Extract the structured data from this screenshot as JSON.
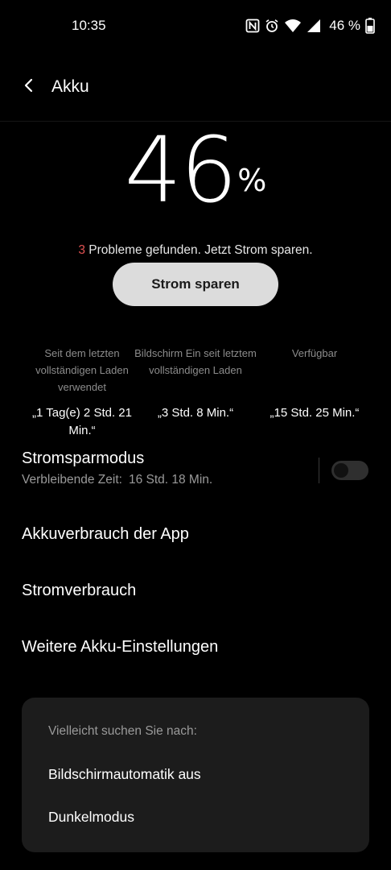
{
  "status_bar": {
    "time": "10:35",
    "icons": [
      "nfc-icon",
      "alarm-icon",
      "wifi-icon",
      "signal-icon",
      "battery-icon"
    ],
    "battery_text": "46 %"
  },
  "app_bar": {
    "title": "Akku"
  },
  "battery": {
    "level": "46",
    "unit": "%"
  },
  "problems": {
    "count": "3",
    "text": " Probleme gefunden. Jetzt Strom sparen."
  },
  "save_button": {
    "label": "Strom sparen"
  },
  "stats": [
    {
      "label": "Seit dem letzten vollständigen Laden verwendet",
      "value": "„1 Tag(e) 2 Std. 21 Min.“"
    },
    {
      "label": "Bildschirm Ein seit letztem vollständigen Laden",
      "value": "„3 Std. 8 Min.“"
    },
    {
      "label": "Verfügbar",
      "value": "„15 Std. 25 Min.“"
    }
  ],
  "power_saving": {
    "title": "Stromsparmodus",
    "remaining_label": "Verbleibende Zeit:",
    "remaining_value": "16 Std. 18 Min.",
    "enabled": false
  },
  "menu": {
    "app_usage": "Akkuverbrauch der App",
    "power_consumption": "Stromverbrauch",
    "more_settings": "Weitere Akku-Einstellungen"
  },
  "suggestions": {
    "heading": "Vielleicht suchen Sie nach:",
    "items": [
      "Bildschirmautomatik aus",
      "Dunkelmodus"
    ]
  },
  "colors": {
    "background": "#000000",
    "accent_red": "#e05252",
    "button_bg": "#dcdcdc",
    "card_bg": "#1c1c1c"
  }
}
